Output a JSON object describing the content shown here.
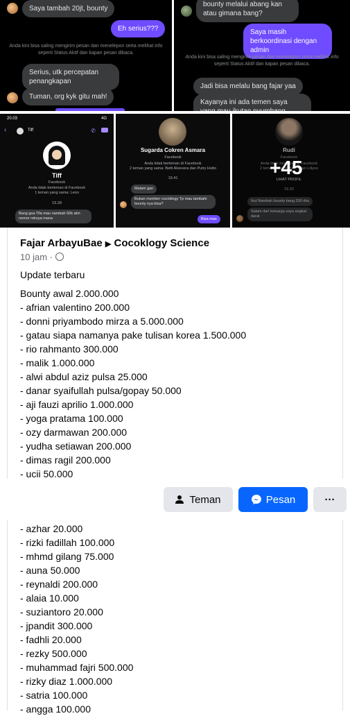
{
  "chat1": {
    "msg1": "Saya tambah 20jt, bounty",
    "msg2": "Eh serius???",
    "system": "Anda kini bisa saling mengirim pesan dan menelepon serta melihat info seperti Status Aktif dan kapan pesan dibaca.",
    "msg3": "Serius, utk percepatan penangkapan",
    "msg4": "Tuman, org kyk gitu mah!"
  },
  "chat2": {
    "msg1": "bounty melalui abang kan atau gimana bang?",
    "msg2": "Saya masih berkoordinasi dengan admin",
    "system": "Anda kini bisa saling mengirim pesan dan menelepon serta melihat info seperti Status Aktif dan kapan pesan dibaca.",
    "msg3": "Jadi bisa melalu bang fajar yaa",
    "msg4": "Kayanya ini ada temen saya yang mau ikutan nyumbang bounty"
  },
  "thumb1": {
    "time": "20.03",
    "signal": "4G",
    "contact": "Tiff",
    "name": "Tiff",
    "platform": "Facebook",
    "info1": "Anda tidak berteman di Facebook",
    "info2": "1 teman yang sama: Leon",
    "stamp": "19.28",
    "msg": "Bang gua Tifa mau nambah 50k atm nomor rekoya mana"
  },
  "thumb2": {
    "name": "Sugarda Cokren Asmara",
    "platform": "Facebook",
    "info1": "Anda tidak berteman di Facebook",
    "info2": "2 teman yang sama: Betti Aloevera dan Putry Hutto",
    "stamp": "19.41",
    "msg1": "Malam gan",
    "msg2": "Bukan member cocoklogy Tp mau tambahi bounty nya bisa?",
    "reply": "Bisa mas"
  },
  "thumb3": {
    "name": "Rudi",
    "platform": "Facebook",
    "info1": "Anda tidak berteman di Facebook",
    "info2": "2 teman yang sama: ... dan Liliyoo",
    "profile_link": "LIHAT PROFIL",
    "stamp": "19.20",
    "msg1": "Ikut Nambah bounty bang 200 ribu",
    "msg2": "Salam dari keluarga saya angkat darat",
    "more": "+45"
  },
  "post": {
    "author": "Fajar ArbayuBae",
    "group": "Cocoklogy Science",
    "time": "10 jam ·",
    "heading": "Update terbaru",
    "lines1": [
      "Bounty awal 2.000.000",
      "- afrian valentino 200.000",
      "- donni priyambodo mirza a 5.000.000",
      "- gatau siapa namanya pake tulisan korea 1.500.000",
      "- rio rahmanto 300.000",
      "- malik 1.000.000",
      "- alwi abdul aziz pulsa 25.000",
      "- danar syaifullah pulsa/gopay 50.000",
      "- aji fauzi aprilio 1.000.000",
      "- yoga pratama 100.000",
      "- ozy darmawan 200.000",
      "- yudha setiawan 200.000",
      "- dimas ragil 200.000",
      "- ucii 50.000"
    ],
    "lines2": [
      "- azhar 20.000",
      "- rizki fadillah 100.000",
      "- mhmd gilang 75.000",
      "- auna 50.000",
      "- reynaldi 200.000",
      "- alaia 10.000",
      "- suziantoro 20.000",
      "- jpandit 300.000",
      "- fadhli 20.000",
      "- rezky 500.000",
      "- muhammad fajri 500.000",
      "- rizky diaz 1.000.000",
      "- satria 100.000",
      "- angga 100.000"
    ]
  },
  "actions": {
    "friend": "Teman",
    "message": "Pesan",
    "more": "···"
  },
  "colors": {
    "accent": "#0866ff",
    "messenger_purple": "#6f4cff"
  }
}
